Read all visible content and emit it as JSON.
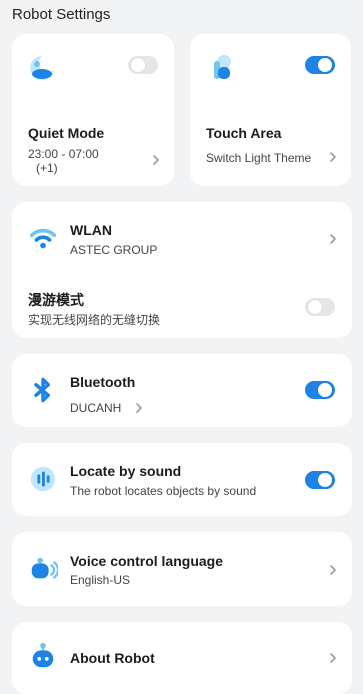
{
  "header": {
    "title": "Robot Settings"
  },
  "quiet": {
    "title": "Quiet Mode",
    "time": "23:00 - 07:00",
    "next_day": "(+1)",
    "toggle": false
  },
  "touch": {
    "title": "Touch Area",
    "subtitle": "Switch Light Theme",
    "toggle": true
  },
  "wlan": {
    "title": "WLAN",
    "network": "ASTEC GROUP"
  },
  "roam": {
    "title": "漫游模式",
    "subtitle": "实现无线网络的无缝切换",
    "toggle": false
  },
  "bluetooth": {
    "title": "Bluetooth",
    "device": "DUCANH",
    "toggle": true
  },
  "locate": {
    "title": "Locate by sound",
    "subtitle": "The robot locates objects by sound",
    "toggle": true
  },
  "voice": {
    "title": "Voice control language",
    "value": "English-US"
  },
  "about": {
    "title": "About Robot"
  },
  "colors": {
    "accent": "#1d84e6",
    "icon_light": "#8fd3f5",
    "background": "#f2f3f5"
  }
}
